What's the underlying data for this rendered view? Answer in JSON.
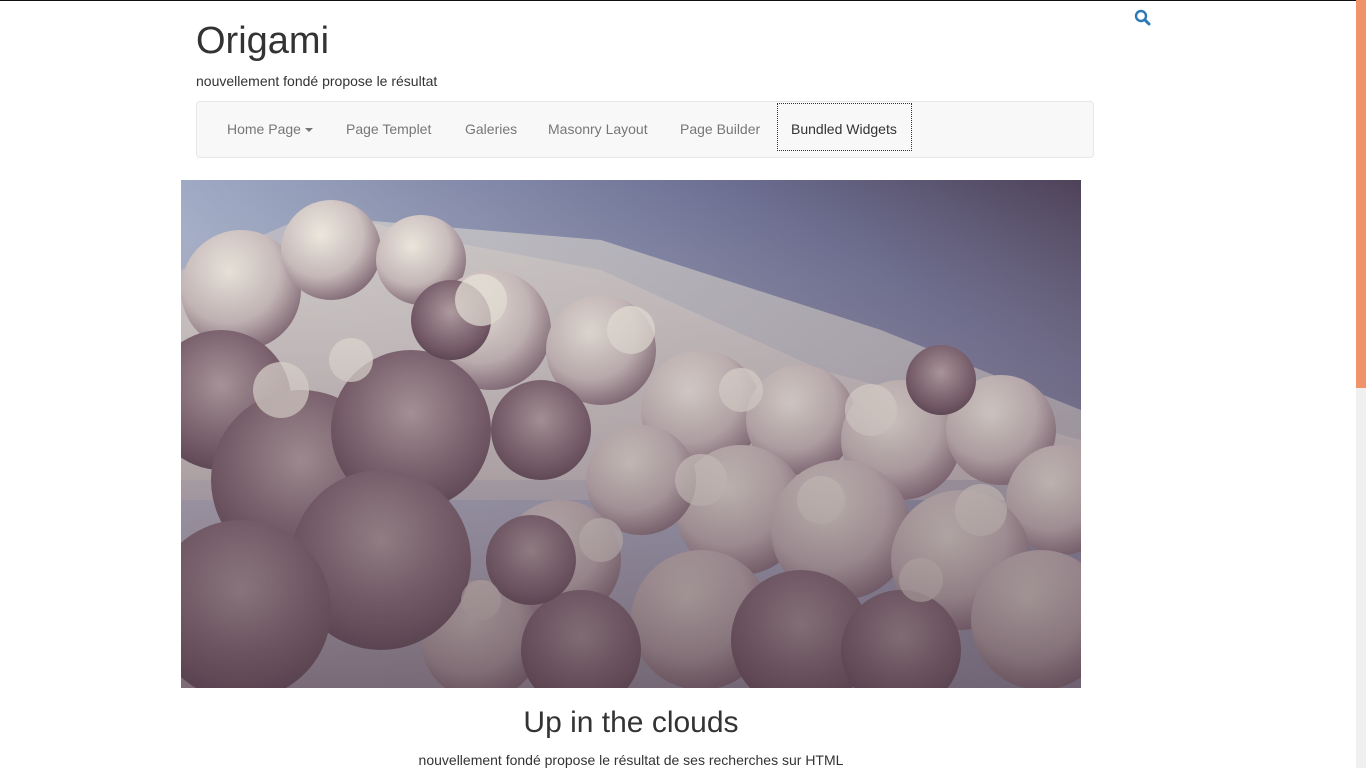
{
  "site": {
    "title": "Origami",
    "tagline": "nouvellement fondé propose le résultat"
  },
  "search": {
    "icon": "search-icon",
    "color": "#2a7ab8"
  },
  "nav": {
    "items": [
      {
        "label": "Home Page",
        "has_dropdown": true
      },
      {
        "label": "Page Templet"
      },
      {
        "label": "Galeries"
      },
      {
        "label": "Masonry Layout"
      },
      {
        "label": "Page Builder"
      },
      {
        "label": "Bundled Widgets",
        "focused": true
      }
    ]
  },
  "hero": {
    "image": "clouds-photo",
    "caption_title": "Up in the clouds",
    "caption_text": "nouvellement fondé propose le résultat de ses recherches sur HTML"
  },
  "scrollbar": {
    "thumb_color": "#f0936a",
    "track_color": "#f0f0f0",
    "position": 0
  }
}
